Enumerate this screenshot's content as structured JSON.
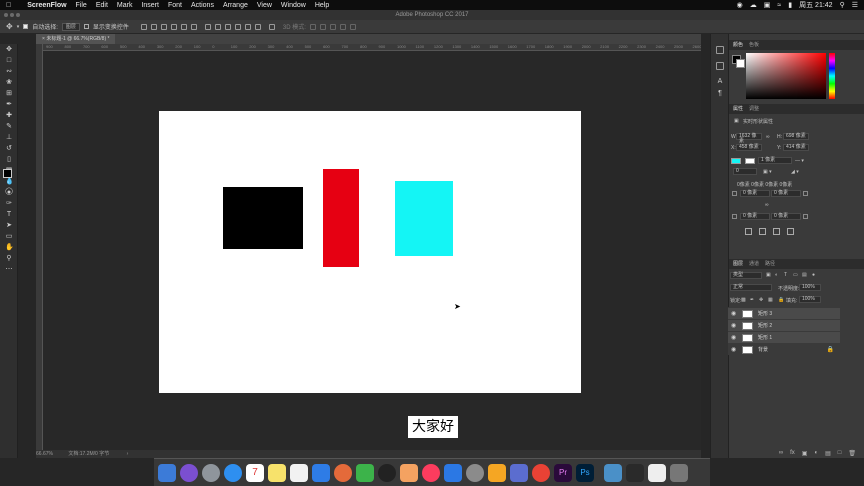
{
  "menubar": {
    "items": [
      "ScreenFlow",
      "File",
      "Edit",
      "Mark",
      "Insert",
      "Font",
      "Actions",
      "Arrange",
      "View",
      "Window",
      "Help"
    ],
    "clock": "周五 21:42"
  },
  "window": {
    "title": "Adobe Photoshop CC 2017"
  },
  "options": {
    "auto_select_label": "自动选择:",
    "auto_select_value": "图层",
    "show_transform_label": "显示变换控件",
    "mode_3d_label": "3D 模式:"
  },
  "document": {
    "tab_title": "未标题-1 @ 66.7%(RGB/8) *",
    "ruler_ticks": [
      "900",
      "800",
      "700",
      "600",
      "500",
      "400",
      "300",
      "200",
      "100",
      "0",
      "100",
      "200",
      "300",
      "400",
      "500",
      "600",
      "700",
      "800",
      "900",
      "1000",
      "1100",
      "1200",
      "1300",
      "1400",
      "1500",
      "1600",
      "1700",
      "1800",
      "1900",
      "2000",
      "2100",
      "2200",
      "2300",
      "2400",
      "2500",
      "2600"
    ]
  },
  "status": {
    "zoom": "66.67%",
    "doc_size": "文档:17.2M/0 字节"
  },
  "subtitle": "大家好",
  "panels": {
    "color_tabs": [
      "颜色",
      "色板"
    ],
    "props_tabs": [
      "属性",
      "调整"
    ],
    "props_title": "实时形状属性",
    "w_label": "W:",
    "w_value": "1632 像素",
    "h_label": "H:",
    "h_value": "698 像素",
    "x_label": "X:",
    "x_value": "458 像素",
    "y_label": "Y:",
    "y_value": "414 像素",
    "stroke_value": "1 像素",
    "corner_caption": "0像素 0像素 0像素 0像素",
    "corner_values": [
      "0 像素",
      "0 像素",
      "0 像素",
      "0 像素"
    ],
    "angle_value": "0",
    "layers_tabs": [
      "图层",
      "通道",
      "路径"
    ],
    "kind_label": "类型",
    "blend_mode": "正常",
    "opacity_label": "不透明度:",
    "opacity_value": "100%",
    "lock_label": "锁定:",
    "fill_label": "填充:",
    "fill_value": "100%",
    "layers": [
      {
        "name": "矩形 3"
      },
      {
        "name": "矩形 2"
      },
      {
        "name": "矩形 1"
      },
      {
        "name": "背景"
      }
    ]
  },
  "colors": {
    "shape_black": "#000000",
    "shape_red": "#e60012",
    "shape_cyan": "#14f5f5",
    "canvas": "#ffffff"
  },
  "dock": {
    "badge_calendar": "7"
  }
}
